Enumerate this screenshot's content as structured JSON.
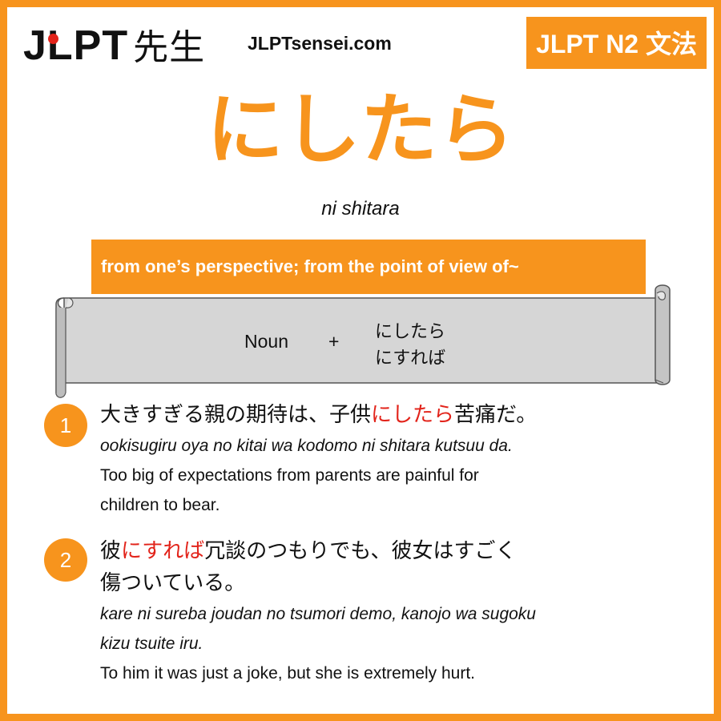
{
  "header": {
    "logo_latin": "JLPT",
    "logo_kanji": "先生",
    "site": "JLPTsensei.com",
    "level_badge": "JLPT N2 文法"
  },
  "grammar": {
    "title": "にしたら",
    "romaji": "ni shitara",
    "meaning": "from one’s perspective; from the point of view of~"
  },
  "formula": {
    "part": "Noun",
    "plus": "+",
    "forms": [
      "にしたら",
      "にすれば"
    ]
  },
  "examples": [
    {
      "number": "1",
      "jp_lines": [
        [
          "大きすぎる親の期待は、子供",
          "にしたら",
          "苦痛だ。"
        ]
      ],
      "romaji_lines": [
        "ookisugiru oya no kitai wa kodomo ni shitara kutsuu da."
      ],
      "english_lines": [
        "Too big of expectations from parents are painful for",
        "children to bear."
      ]
    },
    {
      "number": "2",
      "jp_lines": [
        [
          "彼",
          "にすれば",
          "冗談のつもりでも、彼女はすごく"
        ],
        [
          "傷ついている。",
          "",
          ""
        ]
      ],
      "romaji_lines": [
        "kare ni sureba joudan no tsumori demo, kanojo wa sugoku",
        "kizu tsuite iru."
      ],
      "english_lines": [
        "To him it was just a joke, but she is extremely hurt."
      ]
    }
  ],
  "colors": {
    "accent": "#f7941d",
    "highlight": "#e2231a",
    "scroll_fill": "#d4d4d4"
  }
}
